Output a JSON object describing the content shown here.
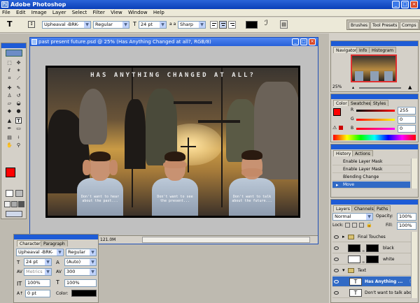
{
  "app": {
    "title": "Adobe Photoshop",
    "icon_label": "Ps"
  },
  "window_buttons": [
    "_",
    "□",
    "×"
  ],
  "menu": [
    "File",
    "Edit",
    "Image",
    "Layer",
    "Select",
    "Filter",
    "View",
    "Window",
    "Help"
  ],
  "options": {
    "tool_glyph": "T",
    "font_family": "Upheaval -BRK-",
    "font_style": "Regular",
    "font_size": "24 pt",
    "aa_label": "a a",
    "antialias": "Sharp",
    "text_color": "#000000"
  },
  "palette_well_tabs": [
    "Brushes",
    "Tool Presets",
    "Comps"
  ],
  "document": {
    "title": "past present future.psd @ 25% (Has Anything Changed at all?, RGB/8)",
    "status": "121.0M",
    "art_title": "HAS ANYTHING CHANGED AT ALL?",
    "captions": [
      "Don't want to hear about the past...",
      "Don't want to see the present...",
      "Don't want to talk about the future..."
    ]
  },
  "navigator": {
    "tabs": [
      "Navigator",
      "Info",
      "Histogram"
    ],
    "zoom": "25%"
  },
  "color": {
    "tabs": [
      "Color",
      "Swatches",
      "Styles"
    ],
    "labels": [
      "R",
      "G",
      "B"
    ],
    "values": [
      "255",
      "0",
      "0"
    ],
    "foreground": "#ff0000"
  },
  "history": {
    "tabs": [
      "History",
      "Actions"
    ],
    "items": [
      "Enable Layer Mask",
      "Enable Layer Mask",
      "Blending Change",
      "Move"
    ]
  },
  "layers": {
    "tabs": [
      "Layers",
      "Channels",
      "Paths"
    ],
    "blend_mode": "Normal",
    "opacity_label": "Opacity:",
    "opacity": "100%",
    "lock_label": "Lock:",
    "fill_label": "Fill:",
    "fill": "100%",
    "rows": [
      "Final Touches",
      "black",
      "white",
      "Text",
      "Has Anything ...",
      "Don't want to talk abo..."
    ]
  },
  "character": {
    "tabs": [
      "Character",
      "Paragraph"
    ],
    "font_family": "Upheaval -BRK-",
    "font_style": "Regular",
    "size": "24 pt",
    "leading": "(Auto)",
    "kerning": "Metrics",
    "tracking": "300",
    "vscale": "100%",
    "hscale": "100%",
    "baseline": "0 pt",
    "color_label": "Color:"
  }
}
